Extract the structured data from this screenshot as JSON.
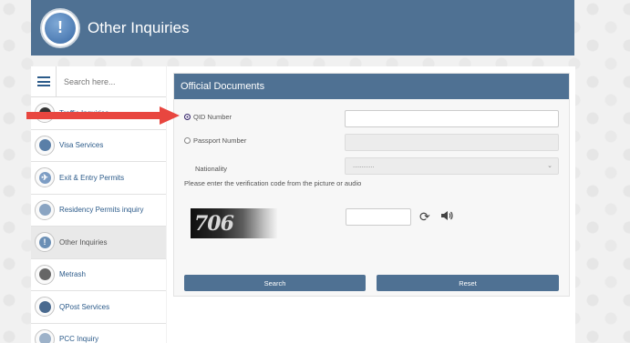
{
  "header": {
    "title": "Other Inquiries",
    "logo_glyph": "!"
  },
  "sidebar": {
    "search_placeholder": "Search here...",
    "items": [
      {
        "label": "Traffic Inquiries",
        "icon": "traffic-light-icon"
      },
      {
        "label": "Visa Services",
        "icon": "visa-icon"
      },
      {
        "label": "Exit & Entry Permits",
        "icon": "plane-icon"
      },
      {
        "label": "Residency Permits inquiry",
        "icon": "residency-icon"
      },
      {
        "label": "Other Inquiries",
        "icon": "exclamation-icon",
        "active": true
      },
      {
        "label": "Metrash",
        "icon": "metrash-icon"
      },
      {
        "label": "QPost Services",
        "icon": "post-truck-icon"
      },
      {
        "label": "PCC Inquiry",
        "icon": "certificate-icon"
      }
    ]
  },
  "form": {
    "title": "Official Documents",
    "qid_label": "QID Number",
    "passport_label": "Passport Number",
    "nationality_label": "Nationality",
    "nationality_value": "............",
    "verification_text": "Please enter the verification code from the picture or audio",
    "captcha_text": "706",
    "search_button": "Search",
    "reset_button": "Reset"
  },
  "colors": {
    "brand": "#4f7193",
    "annotation_arrow": "#e8463f"
  }
}
